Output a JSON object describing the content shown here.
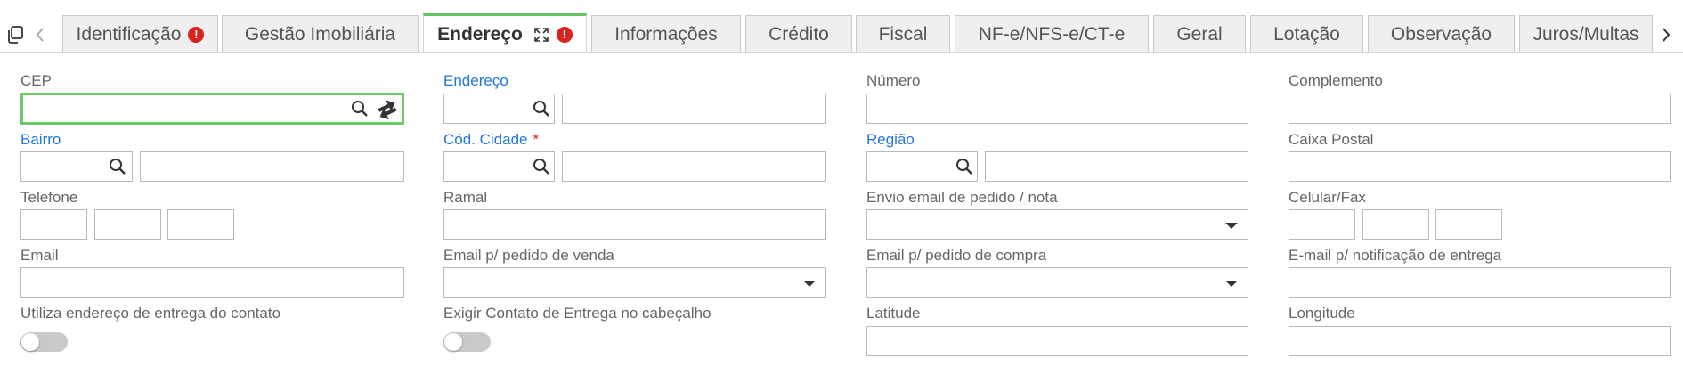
{
  "tabs": [
    {
      "label": "Identificação",
      "error": "!"
    },
    {
      "label": "Gestão Imobiliária"
    },
    {
      "label": "Endereço",
      "error": "!",
      "active": true
    },
    {
      "label": "Informações"
    },
    {
      "label": "Crédito"
    },
    {
      "label": "Fiscal"
    },
    {
      "label": "NF-e/NFS-e/CT-e"
    },
    {
      "label": "Geral"
    },
    {
      "label": "Lotação"
    },
    {
      "label": "Observação"
    },
    {
      "label": "Juros/Multas"
    }
  ],
  "form": {
    "cep": {
      "label": "CEP",
      "value": ""
    },
    "endereco": {
      "label": "Endereço",
      "code": "",
      "description": ""
    },
    "numero": {
      "label": "Número",
      "value": ""
    },
    "complemento": {
      "label": "Complemento",
      "value": ""
    },
    "bairro": {
      "label": "Bairro",
      "code": "",
      "description": ""
    },
    "cod_cidade": {
      "label": "Cód. Cidade",
      "required_mark": "*",
      "code": "",
      "description": ""
    },
    "regiao": {
      "label": "Região",
      "code": "",
      "description": ""
    },
    "caixa_postal": {
      "label": "Caixa Postal",
      "value": ""
    },
    "telefone": {
      "label": "Telefone",
      "ddi": "",
      "ddd": "",
      "numero": ""
    },
    "ramal": {
      "label": "Ramal",
      "value": ""
    },
    "envio_email": {
      "label": "Envio email de pedido / nota",
      "selected": ""
    },
    "celular_fax": {
      "label": "Celular/Fax",
      "ddi": "",
      "ddd": "",
      "numero": ""
    },
    "email": {
      "label": "Email",
      "value": ""
    },
    "email_pedido_venda": {
      "label": "Email p/ pedido de venda",
      "selected": ""
    },
    "email_pedido_compra": {
      "label": "Email p/ pedido de compra",
      "selected": ""
    },
    "email_notificacao_entrega": {
      "label": "E-mail p/ notificação de entrega",
      "value": ""
    },
    "utiliza_endereco_entrega": {
      "label": "Utiliza endereço de entrega do contato",
      "checked": false
    },
    "exigir_contato_entrega": {
      "label": "Exigir Contato de Entrega no cabeçalho",
      "checked": false
    },
    "latitude": {
      "label": "Latitude",
      "value": ""
    },
    "longitude": {
      "label": "Longitude",
      "value": ""
    }
  },
  "colors": {
    "link_label": "#2277d8",
    "active_tab_accent": "#62c462",
    "focus_border": "#6cc96c",
    "error_badge": "#d9231e"
  },
  "icons": {
    "copy": "copy-icon",
    "prev": "chevron-left-icon",
    "next": "chevron-right-icon",
    "search": "search-icon",
    "swap": "swap-icon",
    "expand": "expand-icon",
    "dropdown": "chevron-down-icon"
  }
}
